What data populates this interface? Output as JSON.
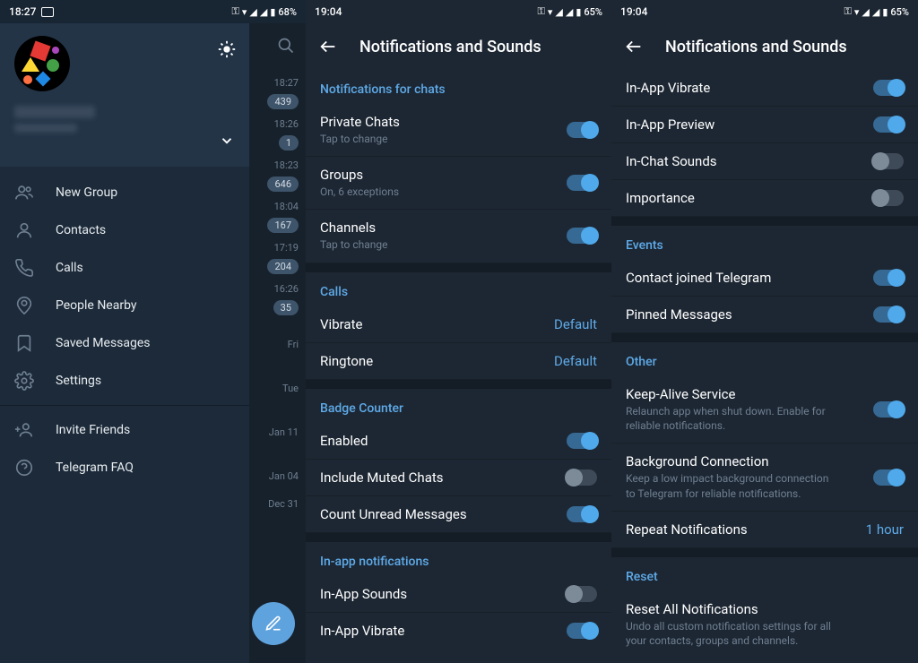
{
  "screen1": {
    "status": {
      "time": "18:27",
      "battery": "68%"
    },
    "drawer": {
      "items": [
        {
          "label": "New Group"
        },
        {
          "label": "Contacts"
        },
        {
          "label": "Calls"
        },
        {
          "label": "People Nearby"
        },
        {
          "label": "Saved Messages"
        },
        {
          "label": "Settings"
        }
      ],
      "items2": [
        {
          "label": "Invite Friends"
        },
        {
          "label": "Telegram FAQ"
        }
      ]
    },
    "chats": [
      {
        "time": "18:27",
        "badge": "439"
      },
      {
        "time": "18:26",
        "badge": "1"
      },
      {
        "time": "18:23",
        "badge": "646"
      },
      {
        "time": "18:04",
        "badge": "167"
      },
      {
        "time": "17:19",
        "badge": "204"
      },
      {
        "time": "16:26",
        "badge": "35"
      },
      {
        "time": "Fri",
        "badge": ""
      },
      {
        "time": "Tue",
        "badge": ""
      },
      {
        "time": "Jan 11",
        "badge": ""
      },
      {
        "time": "Jan 04",
        "badge": ""
      },
      {
        "time": "Dec 31",
        "badge": ""
      }
    ]
  },
  "screen2": {
    "status": {
      "time": "19:04",
      "battery": "65%"
    },
    "title": "Notifications and Sounds",
    "sec1": {
      "header": "Notifications for chats",
      "r1": {
        "title": "Private Chats",
        "sub": "Tap to change"
      },
      "r2": {
        "title": "Groups",
        "sub": "On, 6 exceptions"
      },
      "r3": {
        "title": "Channels",
        "sub": "Tap to change"
      }
    },
    "sec2": {
      "header": "Calls",
      "r1": {
        "title": "Vibrate",
        "value": "Default"
      },
      "r2": {
        "title": "Ringtone",
        "value": "Default"
      }
    },
    "sec3": {
      "header": "Badge Counter",
      "r1": {
        "title": "Enabled"
      },
      "r2": {
        "title": "Include Muted Chats"
      },
      "r3": {
        "title": "Count Unread Messages"
      }
    },
    "sec4": {
      "header": "In-app notifications",
      "r1": {
        "title": "In-App Sounds"
      },
      "r2": {
        "title": "In-App Vibrate"
      }
    }
  },
  "screen3": {
    "status": {
      "time": "19:04",
      "battery": "65%"
    },
    "title": "Notifications and Sounds",
    "top": {
      "r1": {
        "title": "In-App Vibrate"
      },
      "r2": {
        "title": "In-App Preview"
      },
      "r3": {
        "title": "In-Chat Sounds"
      },
      "r4": {
        "title": "Importance"
      }
    },
    "events": {
      "header": "Events",
      "r1": {
        "title": "Contact joined Telegram"
      },
      "r2": {
        "title": "Pinned Messages"
      }
    },
    "other": {
      "header": "Other",
      "r1": {
        "title": "Keep-Alive Service",
        "sub": "Relaunch app when shut down. Enable for reliable notifications."
      },
      "r2": {
        "title": "Background Connection",
        "sub": "Keep a low impact background connection to Telegram for reliable notifications."
      },
      "r3": {
        "title": "Repeat Notifications",
        "value": "1 hour"
      }
    },
    "reset": {
      "header": "Reset",
      "r1": {
        "title": "Reset All Notifications",
        "sub": "Undo all custom notification settings for all your contacts, groups and channels."
      }
    }
  }
}
